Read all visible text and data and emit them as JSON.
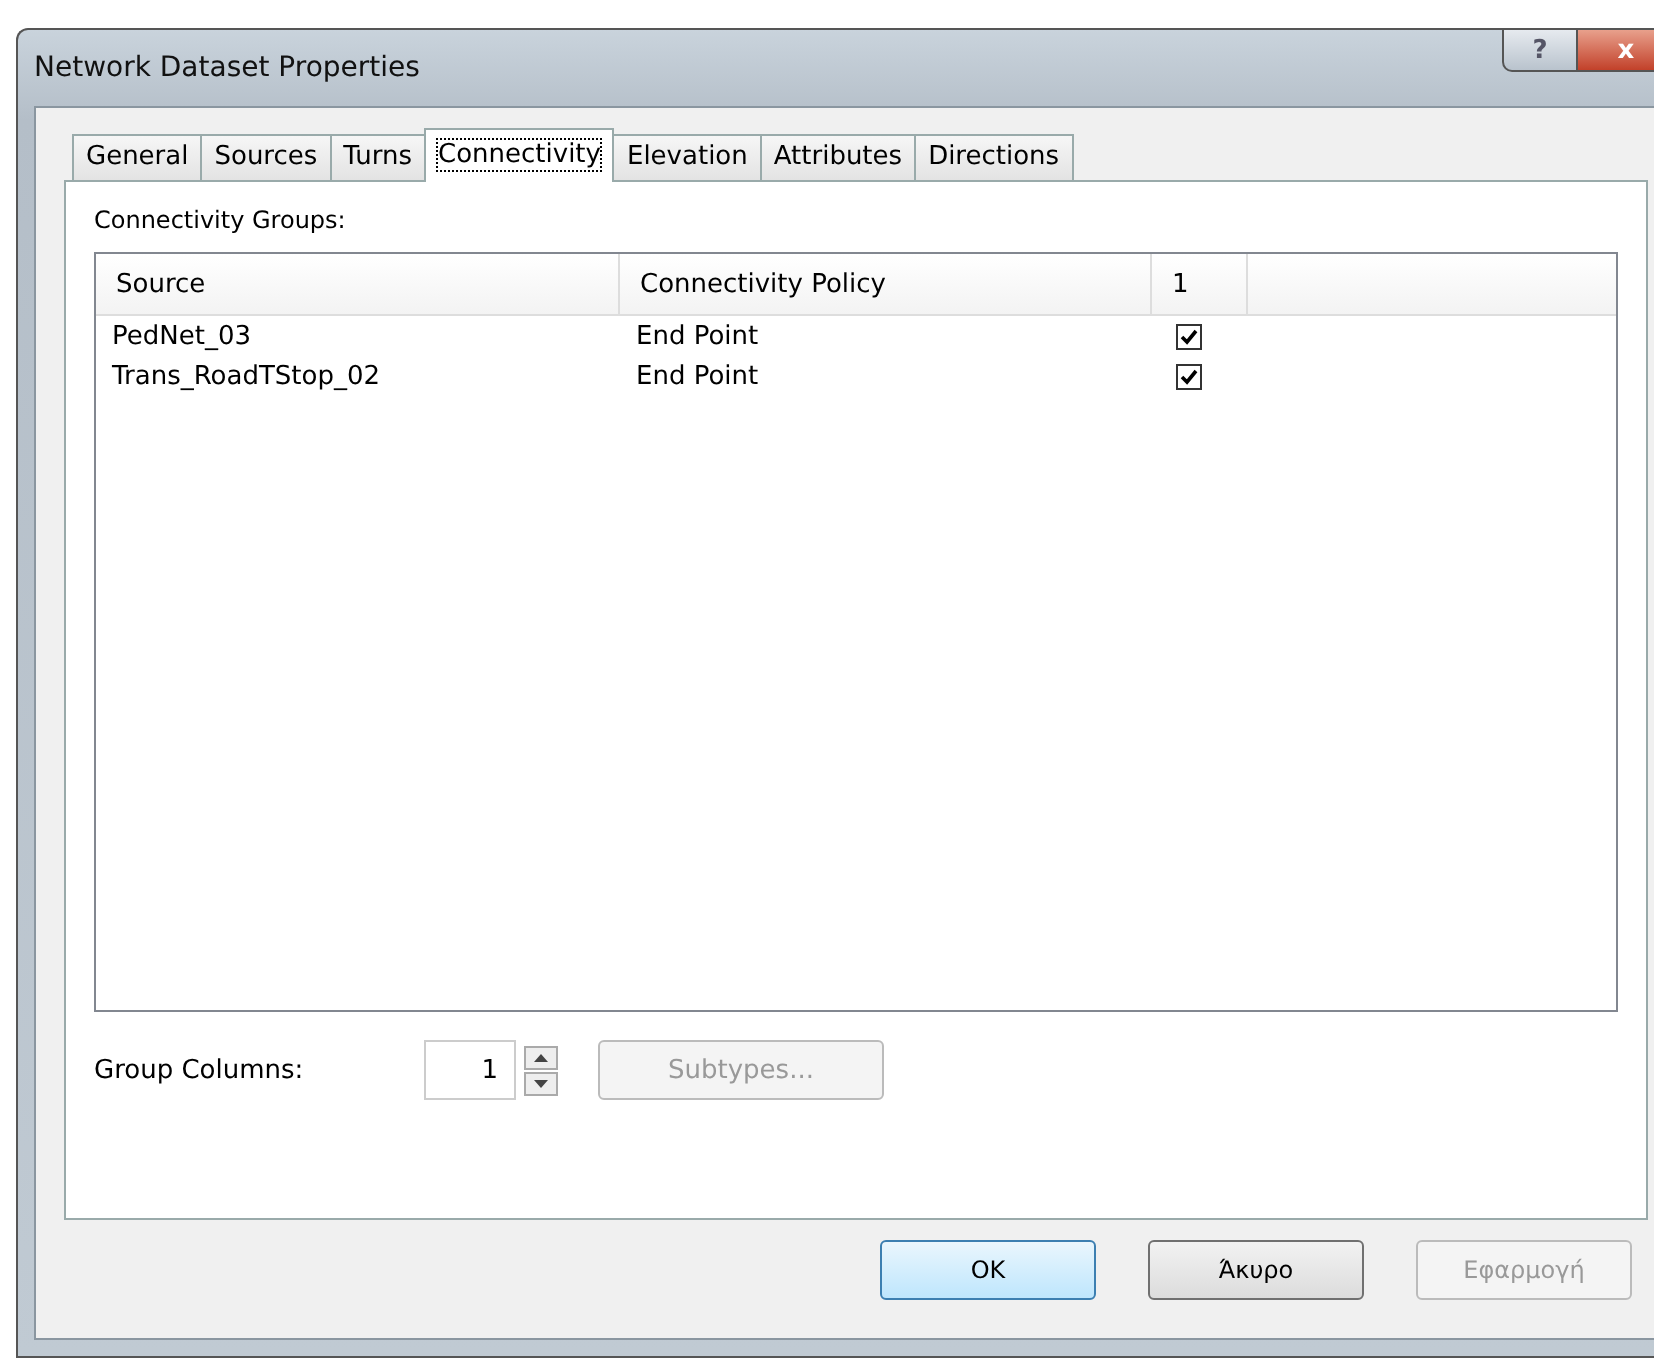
{
  "window": {
    "title": "Network Dataset Properties",
    "buttons": [
      "?",
      "x"
    ]
  },
  "tabs": [
    {
      "label": "General",
      "selected": false
    },
    {
      "label": "Sources",
      "selected": false
    },
    {
      "label": "Turns",
      "selected": false
    },
    {
      "label": "Connectivity",
      "selected": true
    },
    {
      "label": "Elevation",
      "selected": false
    },
    {
      "label": "Attributes",
      "selected": false
    },
    {
      "label": "Directions",
      "selected": false
    }
  ],
  "groups_label": "Connectivity Groups:",
  "table": {
    "columns": [
      "Source",
      "Connectivity Policy",
      "1"
    ],
    "rows": [
      {
        "source": "PedNet_03",
        "policy": "End Point",
        "checked": true
      },
      {
        "source": "Trans_RoadTStop_02",
        "policy": "End Point",
        "checked": true
      }
    ]
  },
  "group_columns": {
    "label": "Group Columns:",
    "value": "1"
  },
  "subtypes_button": {
    "label": "Subtypes...",
    "disabled": true
  },
  "buttons": [
    {
      "label": "OK",
      "default": true,
      "disabled": false
    },
    {
      "label": "Άκυρο",
      "default": false,
      "disabled": false
    },
    {
      "label": "Εφαρμογή",
      "default": false,
      "disabled": true
    }
  ]
}
